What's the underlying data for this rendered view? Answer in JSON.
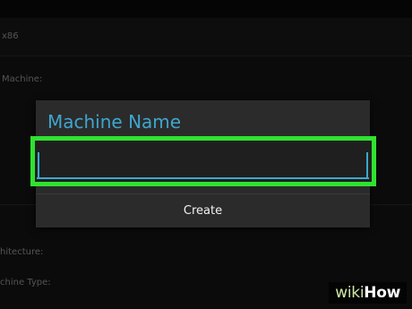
{
  "background": {
    "row_arch_value": "x86",
    "label_machine": "Machine:",
    "label_architecture": "hitecture:",
    "label_machine_type": "chine Type:"
  },
  "dialog": {
    "title": "Machine Name",
    "input_value": "",
    "button_label": "Create"
  },
  "colors": {
    "accent": "#3da7cf",
    "highlight": "#2fe32f",
    "dialog_bg": "#2b2b2b"
  },
  "watermark": {
    "prefix": "wiki",
    "suffix": "How"
  }
}
